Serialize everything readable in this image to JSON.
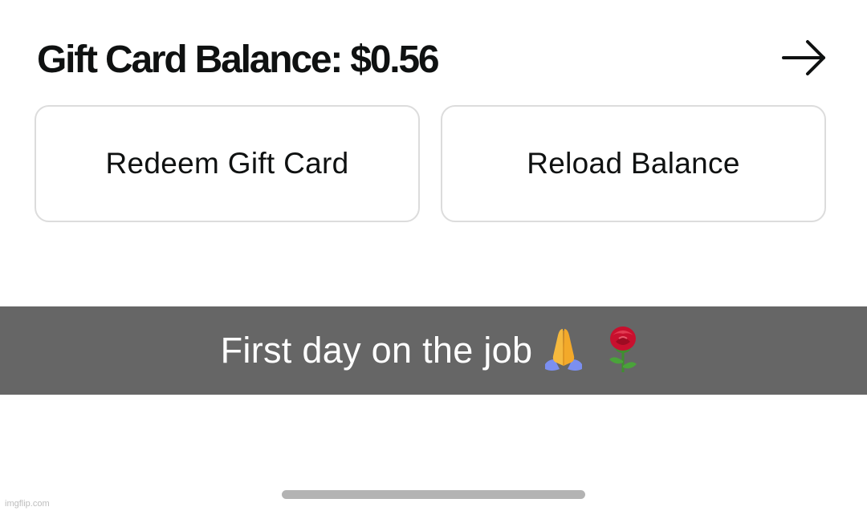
{
  "header": {
    "balance_title": "Gift Card Balance: $0.56",
    "arrow_icon": "arrow-right-icon"
  },
  "actions": {
    "redeem_label": "Redeem Gift Card",
    "reload_label": "Reload Balance"
  },
  "caption": {
    "text": "First day on the job",
    "emojis": [
      "folded-hands-icon",
      "rose-icon"
    ]
  },
  "watermark": {
    "text": "imgflip.com"
  },
  "colors": {
    "text": "#0f1111",
    "button_border": "#dcdcdc",
    "caption_background": "#666666",
    "caption_text": "#ffffff",
    "home_indicator": "#b3b3b3"
  }
}
